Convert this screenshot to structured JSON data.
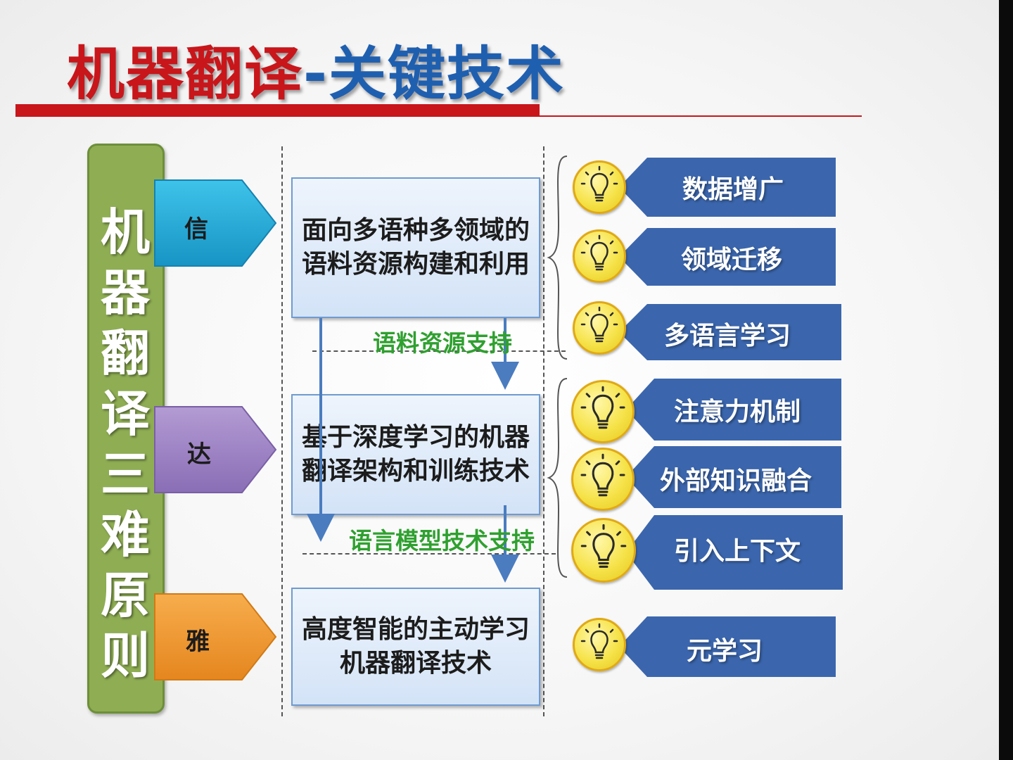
{
  "title": {
    "part1": "机器翻译",
    "part2": "-关键技术"
  },
  "pillar": {
    "chars": [
      "机",
      "器",
      "翻",
      "译",
      "三",
      "难",
      "原",
      "则"
    ]
  },
  "principles": [
    {
      "label": "信",
      "color_top": "#3ec3ea",
      "color_bottom": "#1794c4"
    },
    {
      "label": "达",
      "color_top": "#b39bd3",
      "color_bottom": "#8a6eb6"
    },
    {
      "label": "雅",
      "color_top": "#f7ad4c",
      "color_bottom": "#e5861f"
    }
  ],
  "tech_boxes": [
    {
      "text": "面向多语种多领域的语料资源构建和利用"
    },
    {
      "text": "基于深度学习的机器翻译架构和训练技术"
    },
    {
      "text": "高度智能的主动学习机器翻译技术"
    }
  ],
  "supports": [
    {
      "text": "语料资源支持"
    },
    {
      "text": "语言模型技术支持"
    }
  ],
  "techniques": [
    {
      "label": "数据增广"
    },
    {
      "label": "领域迁移"
    },
    {
      "label": "多语言学习"
    },
    {
      "label": "注意力机制"
    },
    {
      "label": "外部知识融合"
    },
    {
      "label": "引入上下文"
    },
    {
      "label": "元学习"
    }
  ],
  "colors": {
    "red": "#c8161b",
    "blue": "#1f5fb0",
    "pillar_green": "#8fae53",
    "support_green": "#2fa02f",
    "tag_blue": "#3b66ad",
    "bulb_yellow": "#f6e34a"
  }
}
